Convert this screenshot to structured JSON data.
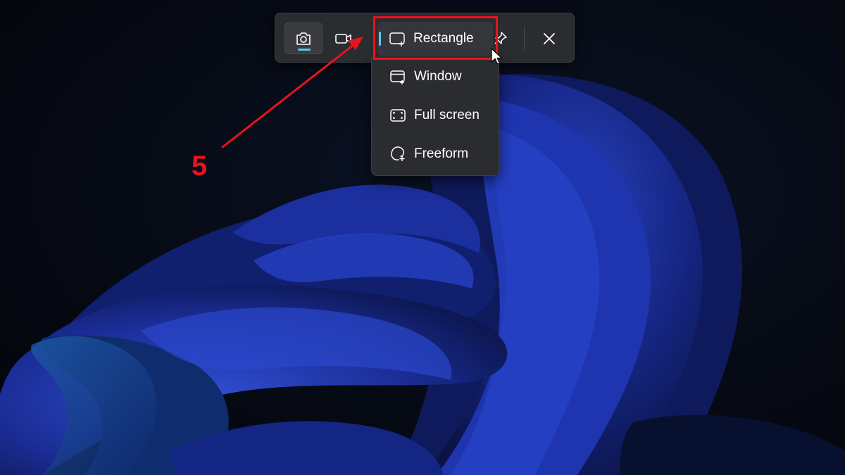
{
  "toolbar": {
    "screenshot_icon": "camera-icon",
    "video_icon": "video-camera-icon",
    "pin_icon": "pin-icon",
    "close_icon": "close-icon",
    "accent_color": "#5cc6f4"
  },
  "mode_button": {
    "label": "Rectangle",
    "icon": "rectangle-snip-icon"
  },
  "mode_menu": {
    "items": [
      {
        "label": "Window",
        "icon": "window-snip-icon"
      },
      {
        "label": "Full screen",
        "icon": "fullscreen-snip-icon"
      },
      {
        "label": "Freeform",
        "icon": "freeform-snip-icon"
      }
    ]
  },
  "annotation": {
    "step": "5",
    "color": "#e8141c"
  }
}
